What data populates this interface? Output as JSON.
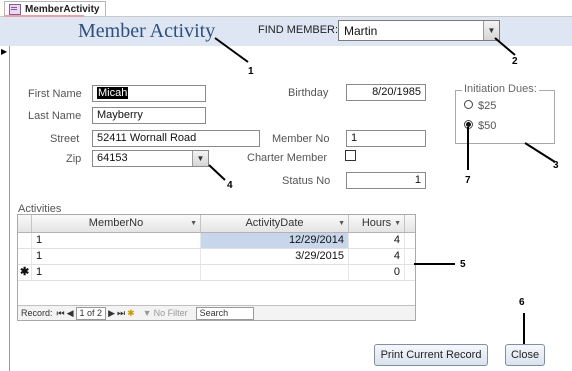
{
  "tab": {
    "label": "MemberActivity"
  },
  "form": {
    "title": "Member Activity"
  },
  "find_member": {
    "label": "FIND MEMBER:",
    "value": "Martin"
  },
  "fields": {
    "first_name": {
      "label": "First Name",
      "value": "Micah"
    },
    "last_name": {
      "label": "Last Name",
      "value": "Mayberry"
    },
    "street": {
      "label": "Street",
      "value": "52411 Wornall Road"
    },
    "zip": {
      "label": "Zip",
      "value": "64153"
    },
    "birthday": {
      "label": "Birthday",
      "value": "8/20/1985"
    },
    "member_no": {
      "label": "Member No",
      "value": "1"
    },
    "charter_member": {
      "label": "Charter Member",
      "checked": false
    },
    "status_no": {
      "label": "Status No",
      "value": "1"
    }
  },
  "initiation_dues": {
    "label": "Initiation Dues:",
    "options": [
      {
        "label": "$25",
        "selected": false
      },
      {
        "label": "$50",
        "selected": true
      }
    ]
  },
  "activities": {
    "label": "Activities",
    "columns": [
      "MemberNo",
      "ActivityDate",
      "Hours"
    ],
    "rows": [
      {
        "member_no": "1",
        "activity_date": "12/29/2014",
        "hours": "4"
      },
      {
        "member_no": "1",
        "activity_date": "3/29/2015",
        "hours": "4"
      },
      {
        "member_no": "1",
        "activity_date": "",
        "hours": "0"
      }
    ],
    "nav": {
      "record_label": "Record:",
      "position": "1 of 2",
      "filter_label": "No Filter",
      "search_label": "Search"
    }
  },
  "buttons": {
    "print": "Print Current Record",
    "close": "Close"
  },
  "callouts": [
    "1",
    "2",
    "3",
    "4",
    "5",
    "6",
    "7"
  ],
  "colors": {
    "header_bg": "#dde6f2",
    "title": "#2f4f7f",
    "selected_cell": "#c8d6ec"
  }
}
